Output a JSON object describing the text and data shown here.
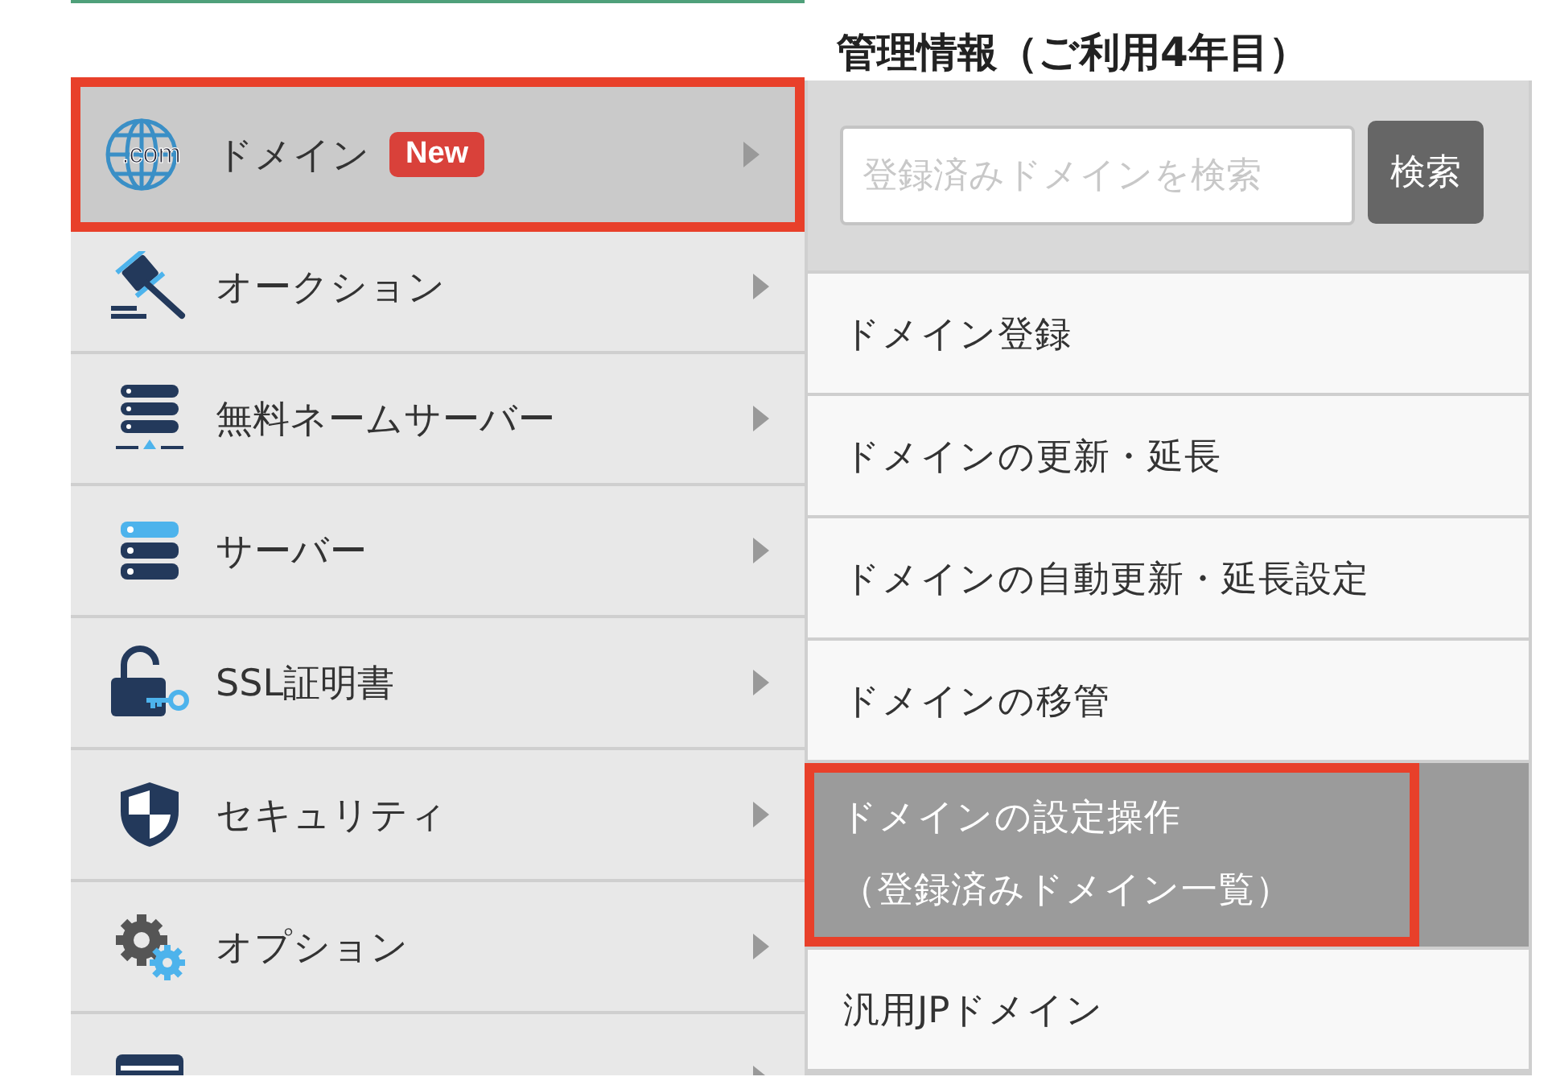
{
  "heading": "管理情報（ご利用4年目）",
  "menu": {
    "items": [
      {
        "label": "ドメイン",
        "icon_text": ".com",
        "badge": "New",
        "selected": true
      },
      {
        "label": "オークション",
        "selected": false
      },
      {
        "label": "無料ネームサーバー",
        "selected": false
      },
      {
        "label": "サーバー",
        "selected": false
      },
      {
        "label": "SSL証明書",
        "selected": false
      },
      {
        "label": "セキュリティ",
        "selected": false
      },
      {
        "label": "オプション",
        "selected": false
      },
      {
        "selected": false
      }
    ]
  },
  "submenu": {
    "search": {
      "placeholder": "登録済みドメインを検索",
      "button": "検索"
    },
    "items": [
      {
        "label": "ドメイン登録",
        "selected": false
      },
      {
        "label": "ドメインの更新・延長",
        "selected": false
      },
      {
        "label": "ドメインの自動更新・延長設定",
        "selected": false
      },
      {
        "label": "ドメインの移管",
        "selected": false
      },
      {
        "label": "ドメインの設定操作",
        "sublabel": "（登録済みドメイン一覧）",
        "selected": true
      },
      {
        "label": "汎用JPドメイン",
        "selected": false
      }
    ]
  }
}
